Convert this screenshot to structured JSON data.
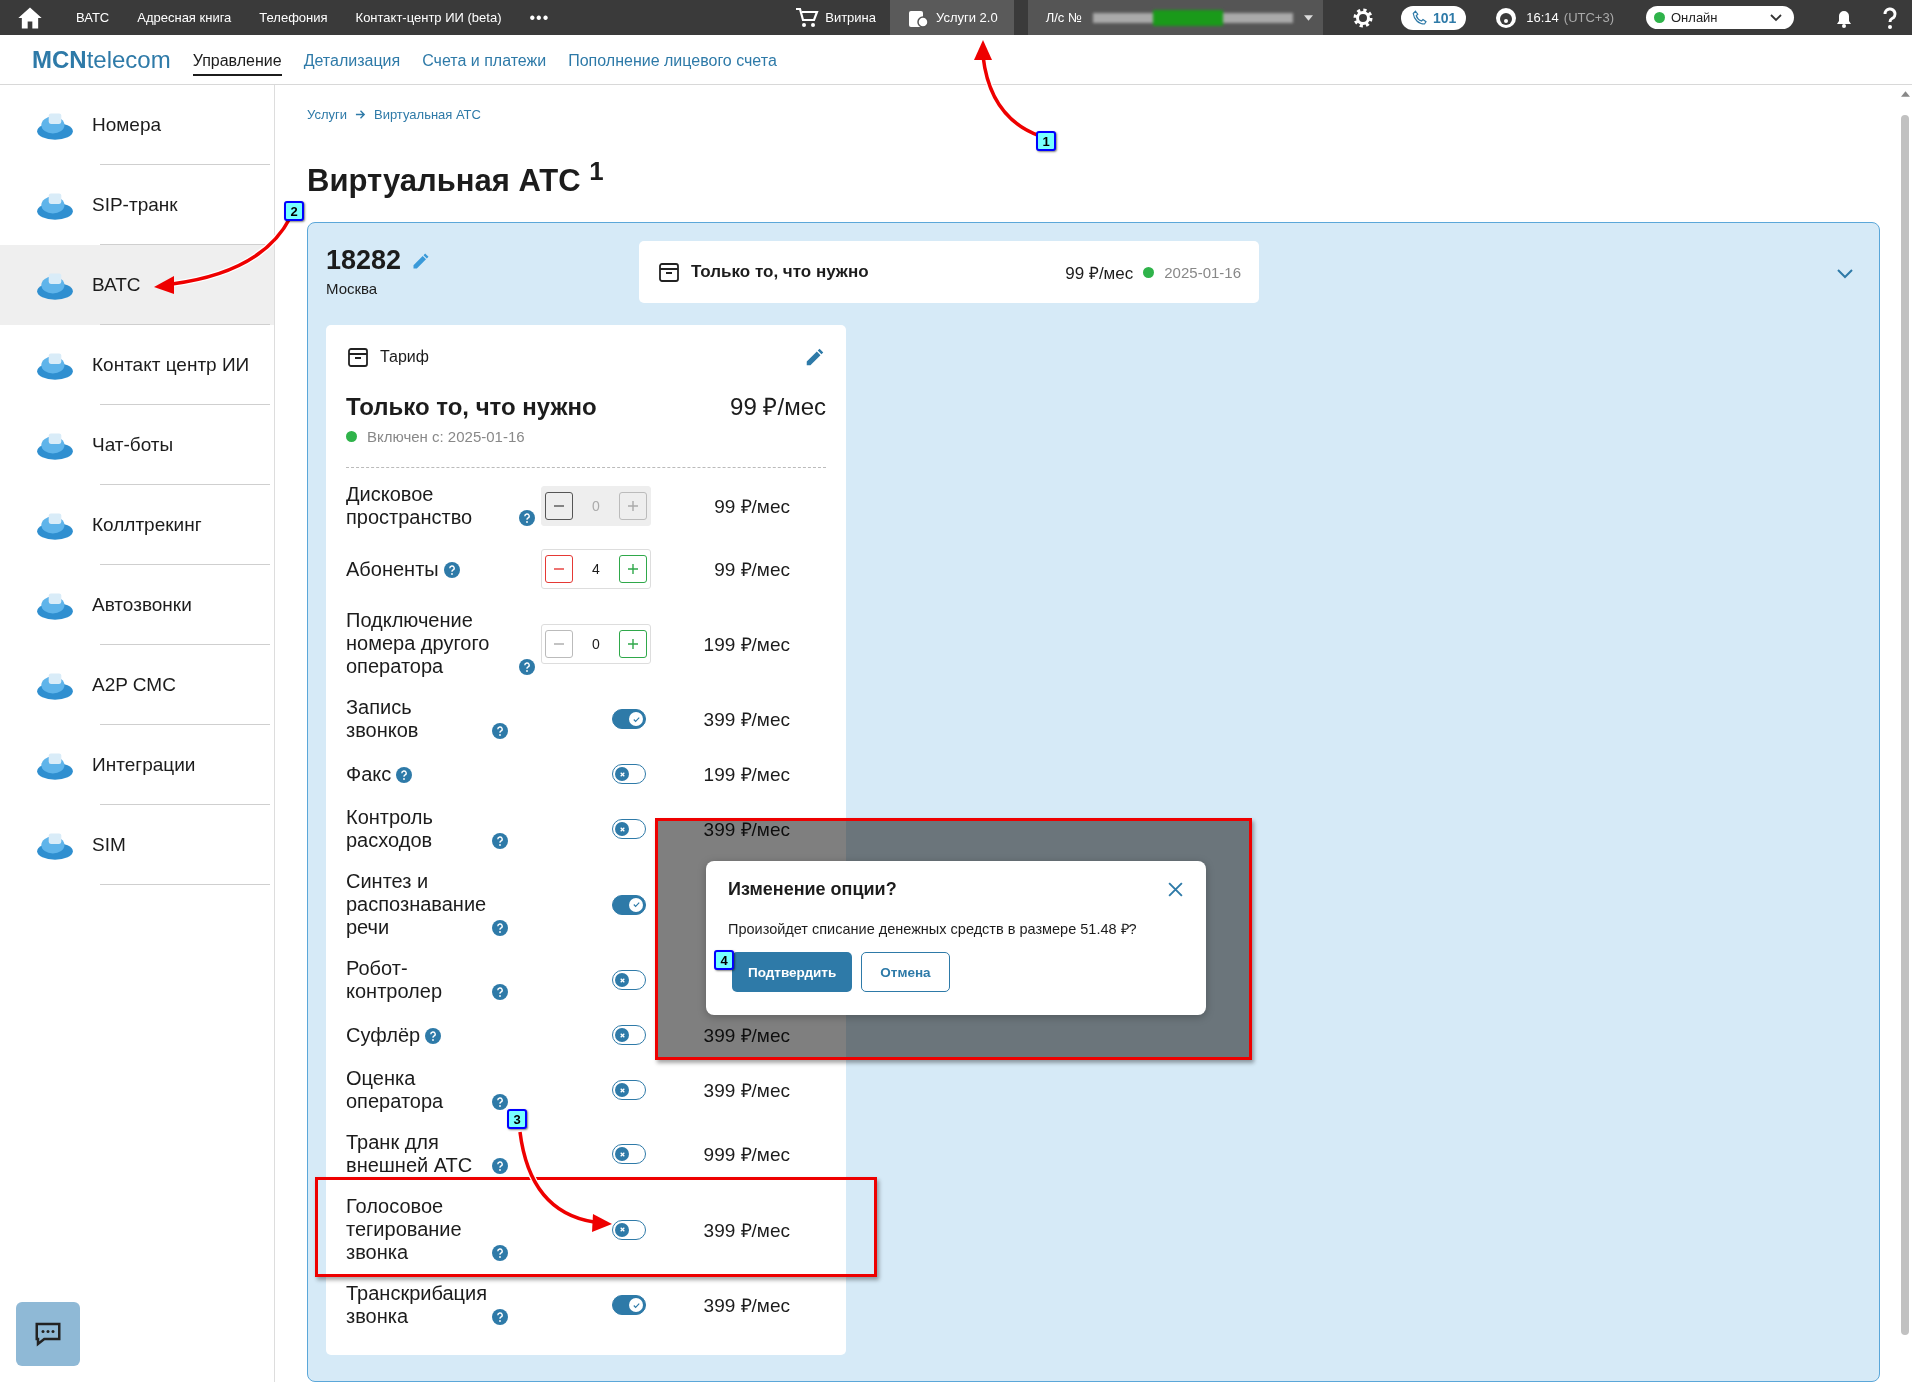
{
  "top_bar": {
    "nav": [
      {
        "label": "ВАТС"
      },
      {
        "label": "Адресная книга"
      },
      {
        "label": "Телефония"
      },
      {
        "label": "Контакт-центр ИИ (beta)"
      }
    ],
    "more": "•••",
    "shop": "Витрина",
    "services": {
      "label": "Услуги 2.0",
      "selected": true
    },
    "account_label": "Л/с №",
    "calls": "101",
    "time": "16:14",
    "timezone": "(UTC+3)",
    "status": {
      "label": "Онлайн",
      "online": true
    }
  },
  "header": {
    "logo": "**MCN**telecom",
    "tabs": [
      {
        "label": "Управление",
        "selected": true
      },
      {
        "label": "Детализация",
        "selected": false
      },
      {
        "label": "Счета и платежи",
        "selected": false
      },
      {
        "label": "Пополнение лицевого счета",
        "selected": false
      }
    ]
  },
  "sidebar": [
    {
      "label": "Номера",
      "selected": false
    },
    {
      "label": "SIP-транк",
      "selected": false
    },
    {
      "label": "ВАТС",
      "selected": true
    },
    {
      "label": "Контакт центр ИИ",
      "selected": false
    },
    {
      "label": "Чат-боты",
      "selected": false
    },
    {
      "label": "Коллтрекинг",
      "selected": false
    },
    {
      "label": "Автозвонки",
      "selected": false
    },
    {
      "label": "A2P СМС",
      "selected": false
    },
    {
      "label": "Интеграции",
      "selected": false
    },
    {
      "label": "SIM",
      "selected": false
    }
  ],
  "breadcrumb": [
    "Услуги",
    "Виртуальная АТС"
  ],
  "title": "Виртуальная АТС $^{1}$",
  "account": {
    "number": "18282",
    "city": "Москва"
  },
  "summary": {
    "name": "Только то, что нужно",
    "price": "99 ₽/мес",
    "date": "2025-01-16",
    "active": true
  },
  "tariff": {
    "heading": "Тариф",
    "name": "Только то, что нужно",
    "price": "99 ₽/мес",
    "status": "Включен с: 2025-01-16",
    "active": true,
    "options": [
      {
        "kind": "stepper",
        "label": "Дисковое пространство",
        "value": "0",
        "disabled": true,
        "can_decrease": false,
        "price": "99 ₽/мес"
      },
      {
        "kind": "stepper",
        "label": "Абоненты",
        "value": "4",
        "disabled": false,
        "can_decrease": true,
        "price": "99 ₽/мес"
      },
      {
        "kind": "stepper",
        "label": "Подключение номера другого оператора",
        "value": "0",
        "disabled": false,
        "can_decrease": false,
        "price": "199 ₽/мес"
      },
      {
        "kind": "toggle",
        "label": "Запись звонков",
        "on": true,
        "price": "399 ₽/мес"
      },
      {
        "kind": "toggle",
        "label": "Факс",
        "on": false,
        "price": "199 ₽/мес"
      },
      {
        "kind": "toggle",
        "label": "Контроль расходов",
        "on": false,
        "price": "399 ₽/мес"
      },
      {
        "kind": "toggle",
        "label": "Синтез и распознавание речи",
        "on": true
      },
      {
        "kind": "toggle",
        "label": "Робот-контролер",
        "on": false
      },
      {
        "kind": "toggle",
        "label": "Суфлёр",
        "on": false,
        "price": "399 ₽/мес"
      },
      {
        "kind": "toggle",
        "label": "Оценка оператора",
        "on": false,
        "price": "399 ₽/мес"
      },
      {
        "kind": "toggle",
        "label": "Транк для внешней АТС",
        "on": false,
        "price": "999 ₽/мес"
      },
      {
        "kind": "toggle",
        "label": "Голосовое тегирование звонка",
        "on": false,
        "price": "399 ₽/мес"
      },
      {
        "kind": "toggle",
        "label": "Транскрибация звонка",
        "on": true,
        "price": "399 ₽/мес"
      }
    ]
  },
  "dialog": {
    "title": "Изменение опции?",
    "message": "Произойдет списание денежных средств в размере 51.48 ₽?",
    "confirm": "Подтвердить",
    "cancel": "Отмена"
  },
  "annotations": {
    "markers": [
      "1",
      "2",
      "3",
      "4"
    ]
  }
}
